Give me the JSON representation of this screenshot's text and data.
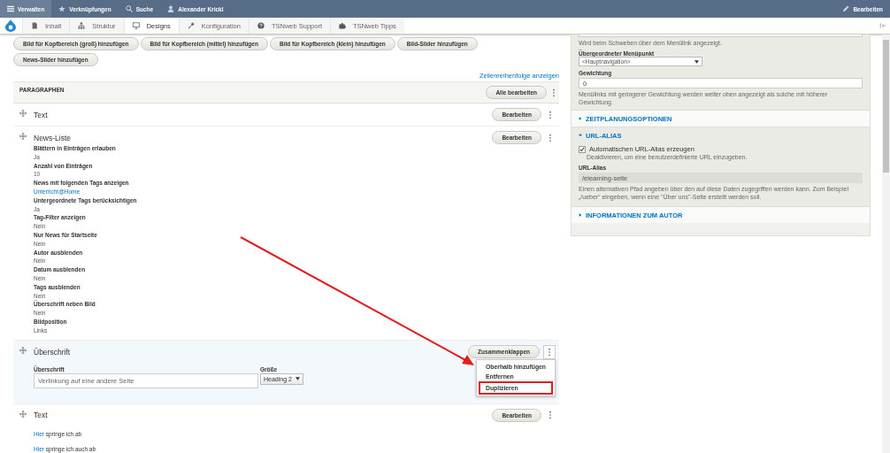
{
  "top_bar": {
    "items": [
      {
        "kind": "menu",
        "label": "Verwalten",
        "selected": true
      },
      {
        "kind": "star",
        "label": "Verknüpfungen",
        "selected": false
      },
      {
        "kind": "search",
        "label": "Suche",
        "selected": false
      },
      {
        "kind": "user",
        "label": "Alexander Krickl",
        "selected": false
      }
    ],
    "edit": "Bearbeiten"
  },
  "toolbar": {
    "items": [
      {
        "kind": "page",
        "label": "Inhalt",
        "selected": false
      },
      {
        "kind": "tree",
        "label": "Struktur",
        "selected": false
      },
      {
        "kind": "monitor",
        "label": "Designs",
        "selected": true
      },
      {
        "kind": "wrench",
        "label": "Konfiguration",
        "selected": false
      },
      {
        "kind": "help",
        "label": "TSNweb Support",
        "selected": false
      },
      {
        "kind": "puzzle",
        "label": "TSNweb Tipps",
        "selected": false
      }
    ]
  },
  "add_buttons": [
    "Bild für Kopfbereich (groß) hinzufügen",
    "Bild für Kopfbereich (mittel) hinzufügen",
    "Bild für Kopfbereich (klein) hinzufügen",
    "Bild-Slider hinzufügen",
    "News-Slider hinzufügen"
  ],
  "row_order_link": "Zeilenreihenfolge anzeigen",
  "paragraphs": {
    "title": "PARAGRAPHEN",
    "edit_all": "Alle bearbeiten",
    "items": [
      {
        "kind": "summary",
        "title": "Text",
        "button": "Bearbeiten"
      },
      {
        "kind": "fields",
        "title": "News-Liste",
        "button": "Bearbeiten",
        "fields": [
          {
            "label": "Blättern in Einträgen erlauben",
            "value": "Ja",
            "link": false
          },
          {
            "label": "Anzahl von Einträgen",
            "value": "10",
            "link": false
          },
          {
            "label": "News mit folgenden Tags anzeigen",
            "value": "Unterricht@Home",
            "link": true
          },
          {
            "label": "Untergeordnete Tags berücksichtigen",
            "value": "Ja",
            "link": false
          },
          {
            "label": "Tag-Filter anzeigen",
            "value": "Nein",
            "link": false
          },
          {
            "label": "Nur News für Startseite",
            "value": "Nein",
            "link": false
          },
          {
            "label": "Autor ausblenden",
            "value": "Nein",
            "link": false
          },
          {
            "label": "Datum ausblenden",
            "value": "Nein",
            "link": false
          },
          {
            "label": "Tags ausblenden",
            "value": "Nein",
            "link": false
          },
          {
            "label": "Überschrift neben Bild",
            "value": "Nein",
            "link": false
          },
          {
            "label": "Bildposition",
            "value": "Links",
            "link": false
          }
        ]
      },
      {
        "kind": "form",
        "title": "Überschrift",
        "button": "Zusammenklappen",
        "heading_label": "Überschrift",
        "heading_placeholder": "Verlinkung auf eine andere Seite",
        "size_label": "Größe",
        "size_value": "Heading 2",
        "menu": [
          {
            "label": "Oberhalb hinzufügen",
            "highlighted": false
          },
          {
            "label": "Entfernen",
            "highlighted": false
          },
          {
            "label": "Duplizieren",
            "highlighted": true
          }
        ]
      },
      {
        "kind": "links",
        "title": "Text",
        "button": "Bearbeiten",
        "lines": [
          {
            "link": "Hier",
            "text": "springe ich ab"
          },
          {
            "link": "Hier",
            "text": "springe ich auch ab"
          }
        ]
      }
    ]
  },
  "sidebar": {
    "title_hint": "Wird beim Schweben über dem Menülink angezeigt.",
    "parent_label": "Übergeordneter Menüpunkt",
    "parent_value": "<Hauptnavigation>",
    "weight_label": "Gewichtung",
    "weight_value": "0",
    "weight_hint": "Menülinks mit geringerer Gewichtung werden weiter oben angezeigt als solche mit höherer Gewichtung.",
    "sections": [
      {
        "title": "ZEITPLANUNGSOPTIONEN",
        "expanded": false
      },
      {
        "title": "URL-ALIAS",
        "expanded": true,
        "checkbox_label": "Automatischen URL-Alias erzeugen",
        "checked": true,
        "checkbox_hint": "Deaktivieren, um eine benutzerdefinierte URL einzugeben.",
        "alias_label": "URL-Alias",
        "alias_value": "/elearning-seite",
        "alias_hint": "Einen alternativen Pfad angeben über den auf diese Daten zugegriffen werden kann. Zum Beispiel „/ueber“ eingeben, wenn eine \"Über uns\"-Seite erstellt werden soll."
      },
      {
        "title": "INFORMATIONEN ZUM AUTOR",
        "expanded": false
      }
    ]
  }
}
